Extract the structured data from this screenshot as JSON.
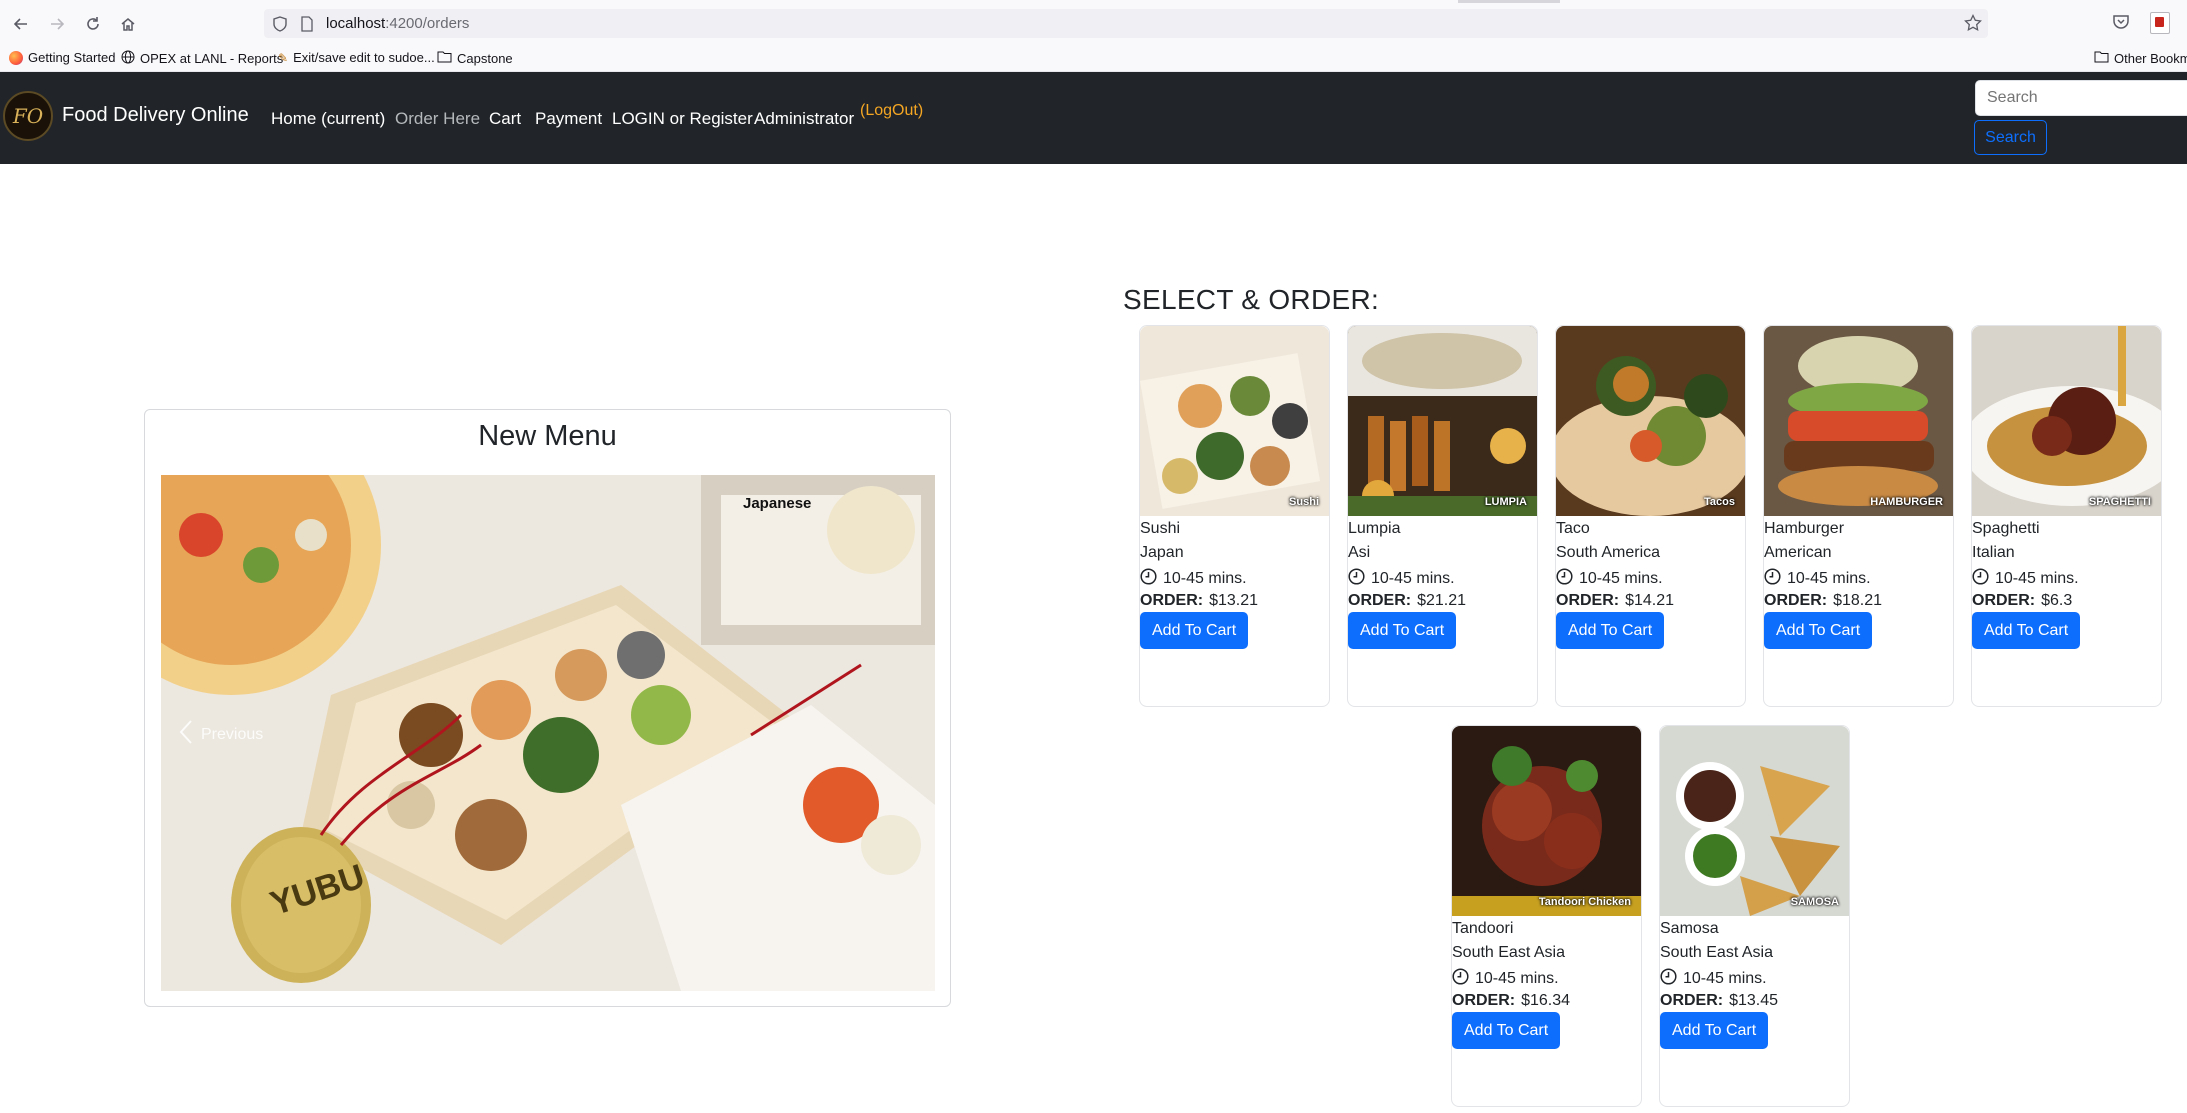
{
  "browser": {
    "url_host": "localhost",
    "url_rest": ":4200/orders",
    "bookmarks": [
      "Getting Started",
      "OPEX at LANL - Reports",
      "Exit/save edit to sudoe...",
      "Capstone"
    ],
    "other_bookmarks": "Other Bookmarks"
  },
  "navbar": {
    "brand": "Food Delivery Online",
    "logo_text": "FO",
    "links": [
      "Home (current)",
      "Order Here",
      "Cart",
      "Payment",
      "LOGIN or Register",
      "Administrator"
    ],
    "logout": "(LogOut)",
    "search_placeholder": "Search",
    "search_button": "Search"
  },
  "menu": {
    "title": "New Menu",
    "slide_caption": "Japanese",
    "prev_label": "Previous"
  },
  "order": {
    "title": "SELECT & ORDER:",
    "time_label": "10-45 mins.",
    "order_label": "ORDER:",
    "add_button": "Add To Cart",
    "items": [
      {
        "name": "Sushi",
        "origin": "Japan",
        "price": "$13.21",
        "img_label": "Sushi"
      },
      {
        "name": "Lumpia",
        "origin": "Asi",
        "price": "$21.21",
        "img_label": "LUMPIA"
      },
      {
        "name": "Taco",
        "origin": "South America",
        "price": "$14.21",
        "img_label": "Tacos"
      },
      {
        "name": "Hamburger",
        "origin": "American",
        "price": "$18.21",
        "img_label": "HAMBURGER"
      },
      {
        "name": "Spaghetti",
        "origin": "Italian",
        "price": "$6.3",
        "img_label": "SPAGHETTI"
      },
      {
        "name": "Tandoori",
        "origin": "South East Asia",
        "price": "$16.34",
        "img_label": "Tandoori Chicken"
      },
      {
        "name": "Samosa",
        "origin": "South East Asia",
        "price": "$13.45",
        "img_label": "SAMOSA"
      }
    ]
  }
}
